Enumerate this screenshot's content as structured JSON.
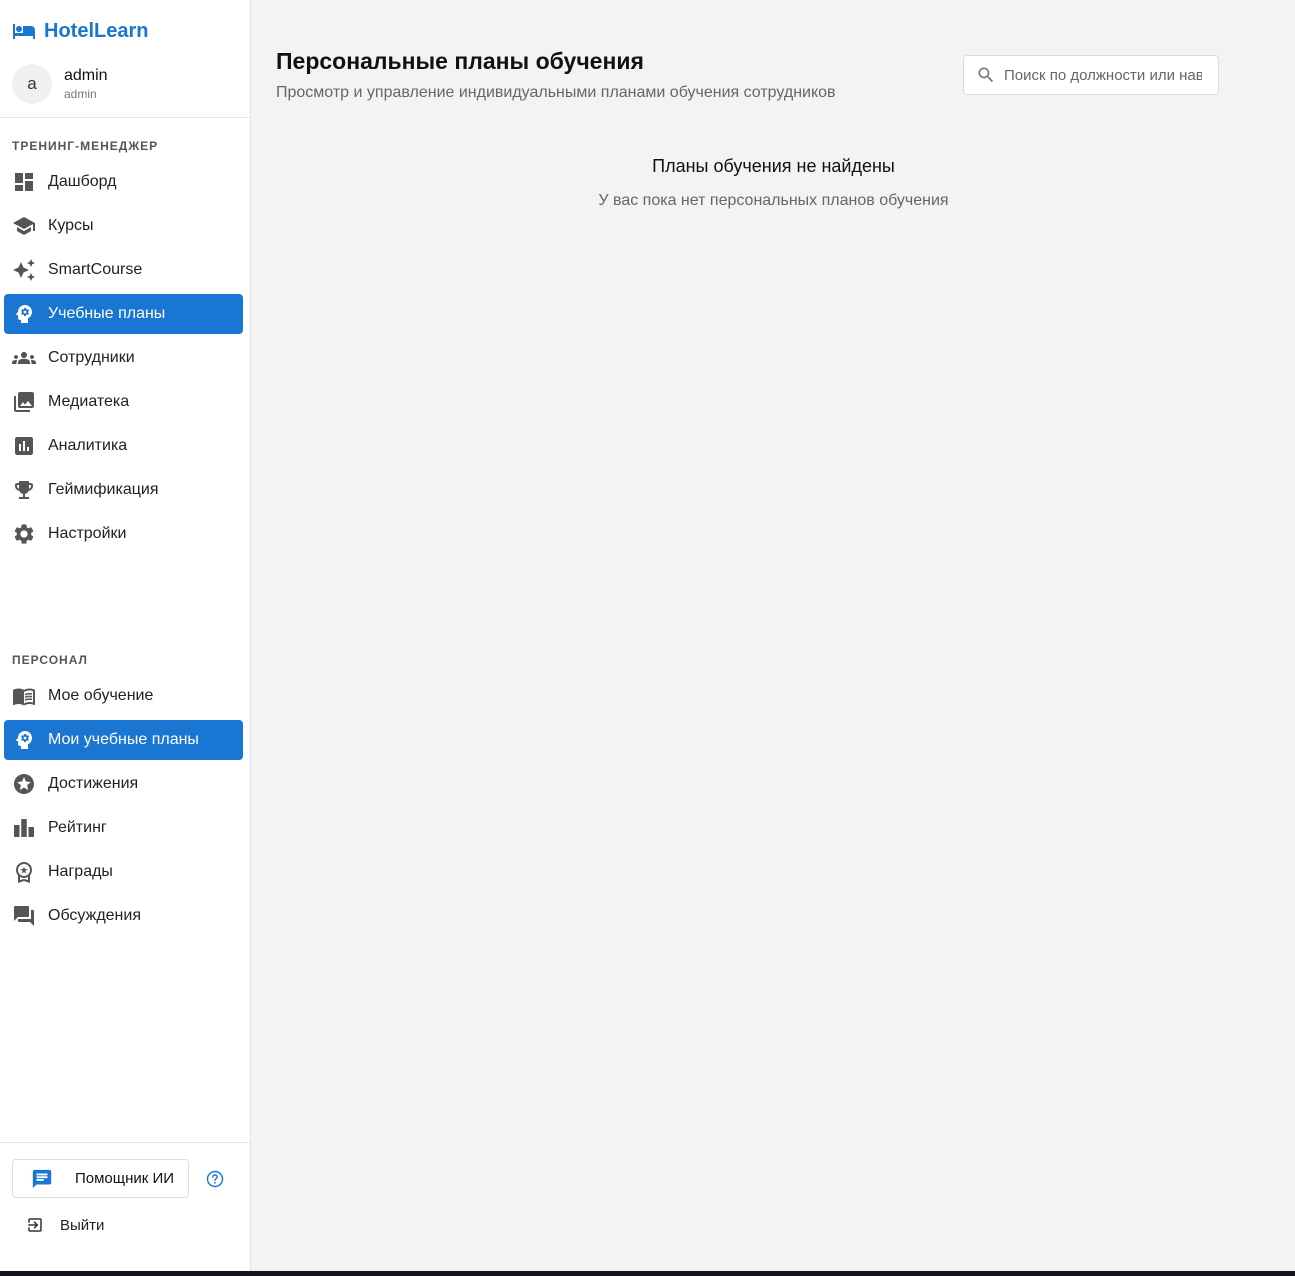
{
  "brand": {
    "name": "HotelLearn"
  },
  "user": {
    "avatar_letter": "a",
    "name": "admin",
    "role": "admin"
  },
  "sidebar": {
    "manager_section": "ТРЕНИНГ-МЕНЕДЖЕР",
    "manager_items": [
      {
        "label": "Дашборд",
        "icon": "dashboard-icon"
      },
      {
        "label": "Курсы",
        "icon": "school-icon"
      },
      {
        "label": "SmartCourse",
        "icon": "sparkles-icon"
      },
      {
        "label": "Учебные планы",
        "icon": "psychology-icon",
        "active": true
      },
      {
        "label": "Сотрудники",
        "icon": "groups-icon"
      },
      {
        "label": "Медиатека",
        "icon": "photo-library-icon"
      },
      {
        "label": "Аналитика",
        "icon": "analytics-icon"
      },
      {
        "label": "Геймификация",
        "icon": "trophy-icon"
      },
      {
        "label": "Настройки",
        "icon": "settings-icon"
      }
    ],
    "personal_section": "ПЕРСОНАЛ",
    "personal_items": [
      {
        "label": "Мое обучение",
        "icon": "menu-book-icon"
      },
      {
        "label": "Мои учебные планы",
        "icon": "psychology-icon",
        "active": true
      },
      {
        "label": "Достижения",
        "icon": "stars-icon"
      },
      {
        "label": "Рейтинг",
        "icon": "leaderboard-icon"
      },
      {
        "label": "Награды",
        "icon": "award-icon"
      },
      {
        "label": "Обсуждения",
        "icon": "forum-icon"
      }
    ],
    "ai_assistant": "Помощник ИИ",
    "logout": "Выйти"
  },
  "main": {
    "title": "Персональные планы обучения",
    "subtitle": "Просмотр и управление индивидуальными планами обучения сотрудников",
    "search_placeholder": "Поиск по должности или навыкам",
    "empty_title": "Планы обучения не найдены",
    "empty_text": "У вас пока нет персональных планов обучения"
  },
  "colors": {
    "accent": "#1976d2",
    "background": "#f3f3f3",
    "sidebar": "#ffffff"
  }
}
